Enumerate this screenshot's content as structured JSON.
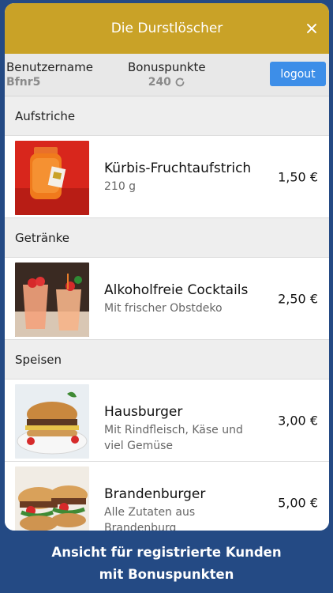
{
  "header": {
    "title": "Die Durstlöscher",
    "close_icon": "close-icon"
  },
  "user": {
    "username_label": "Benutzername",
    "username_value": "Bfnr5",
    "points_label": "Bonuspunkte",
    "points_value": "240",
    "logout_label": "logout"
  },
  "sections": [
    {
      "title": "Aufstriche",
      "items": [
        {
          "name": "Kürbis-Fruchtaufstrich",
          "desc": "210 g",
          "price": "1,50 €"
        }
      ]
    },
    {
      "title": "Getränke",
      "items": [
        {
          "name": "Alkoholfreie Cocktails",
          "desc": "Mit frischer Obstdeko",
          "price": "2,50 €"
        }
      ]
    },
    {
      "title": "Speisen",
      "items": [
        {
          "name": "Hausburger",
          "desc": "Mit Rindfleisch, Käse und viel Gemüse",
          "price": "3,00 €"
        },
        {
          "name": "Brandenburger",
          "desc": "Alle Zutaten aus Brandenburg",
          "price": "5,00 €"
        }
      ]
    }
  ],
  "footer": {
    "line1": "Ansicht für registrierte Kunden",
    "line2": "mit Bonuspunkten"
  },
  "colors": {
    "titlebar": "#c9a227",
    "background": "#244a84",
    "logout_button": "#3d8ee8"
  }
}
